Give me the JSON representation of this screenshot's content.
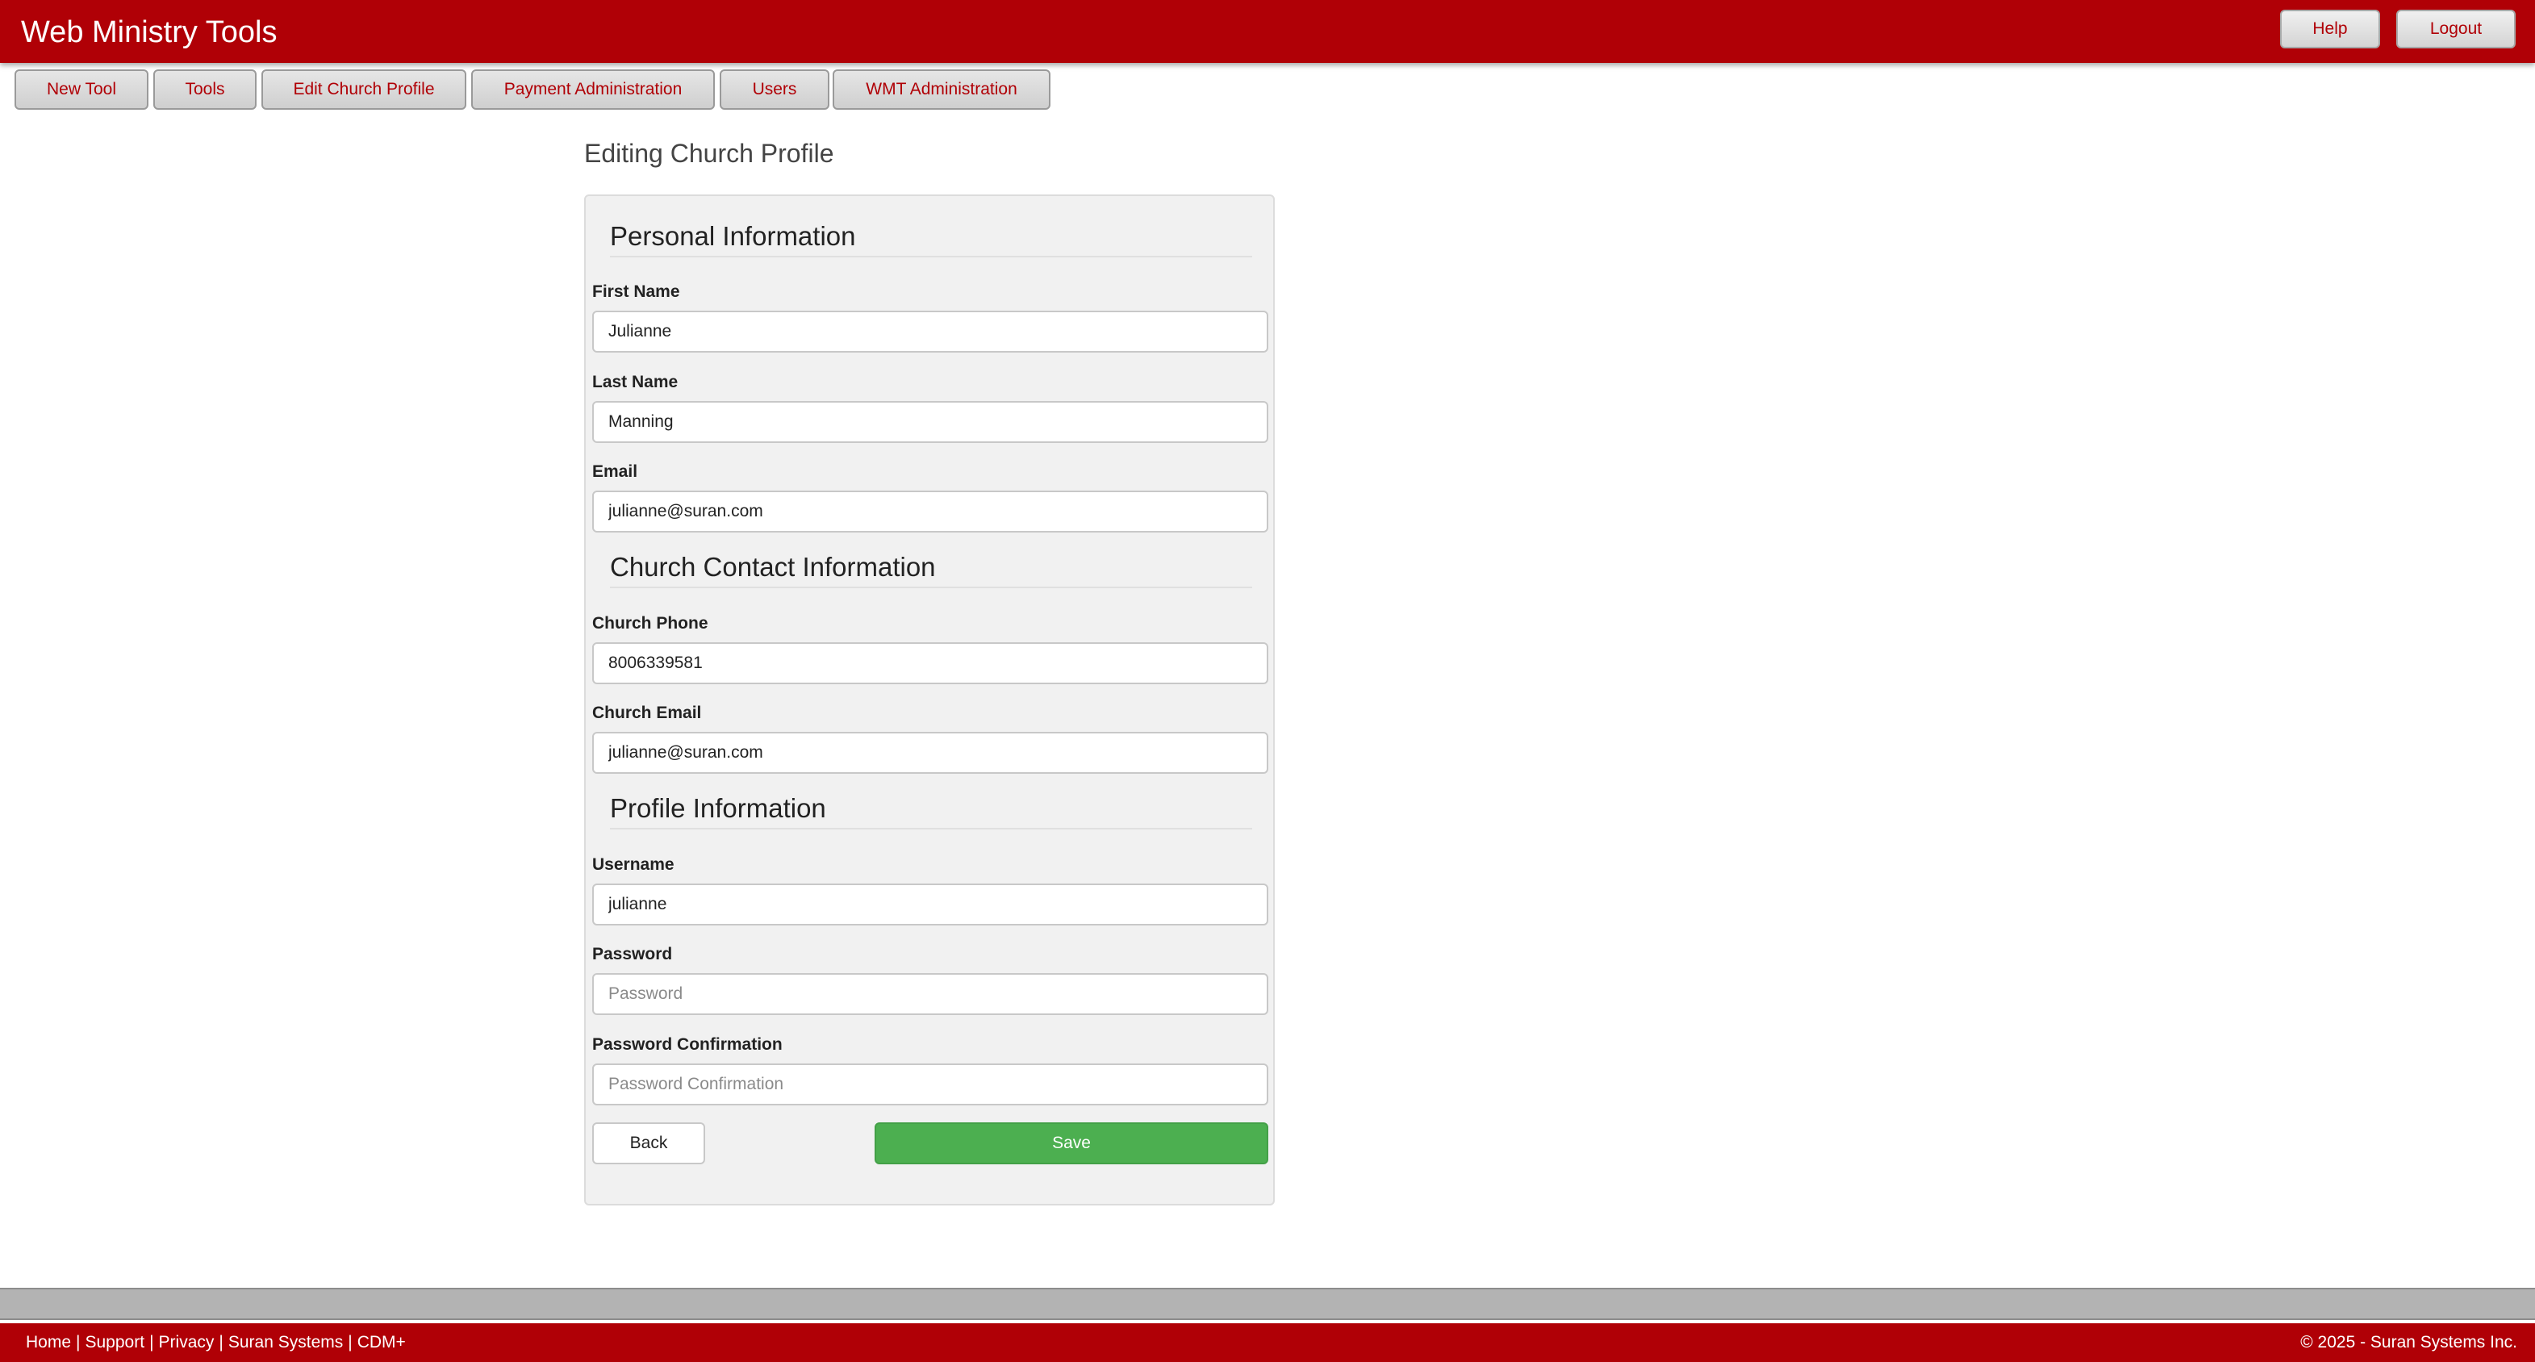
{
  "header": {
    "title": "Web Ministry Tools",
    "help_label": "Help",
    "logout_label": "Logout"
  },
  "nav": {
    "items": [
      {
        "label": "New Tool"
      },
      {
        "label": "Tools"
      },
      {
        "label": "Edit Church Profile"
      },
      {
        "label": "Payment Administration"
      },
      {
        "label": "Users"
      },
      {
        "label": "WMT Administration"
      }
    ]
  },
  "page": {
    "title": "Editing Church Profile"
  },
  "form": {
    "personal": {
      "heading": "Personal Information",
      "first_name": {
        "label": "First Name",
        "value": "Julianne"
      },
      "last_name": {
        "label": "Last Name",
        "value": "Manning"
      },
      "email": {
        "label": "Email",
        "value": "julianne@suran.com"
      }
    },
    "church": {
      "heading": "Church Contact Information",
      "phone": {
        "label": "Church Phone",
        "value": "8006339581"
      },
      "email": {
        "label": "Church Email",
        "value": "julianne@suran.com"
      }
    },
    "profile": {
      "heading": "Profile Information",
      "username": {
        "label": "Username",
        "value": "julianne"
      },
      "password": {
        "label": "Password",
        "placeholder": "Password"
      },
      "password_confirmation": {
        "label": "Password Confirmation",
        "placeholder": "Password Confirmation"
      }
    },
    "back_label": "Back",
    "save_label": "Save"
  },
  "footer": {
    "links": [
      {
        "label": "Home"
      },
      {
        "label": "Support"
      },
      {
        "label": "Privacy"
      },
      {
        "label": "Suran Systems"
      },
      {
        "label": "CDM+"
      }
    ],
    "separator": "|",
    "copyright": "© 2025 - Suran Systems Inc."
  },
  "colors": {
    "brand_red": "#b00006",
    "save_green": "#4caf50"
  }
}
